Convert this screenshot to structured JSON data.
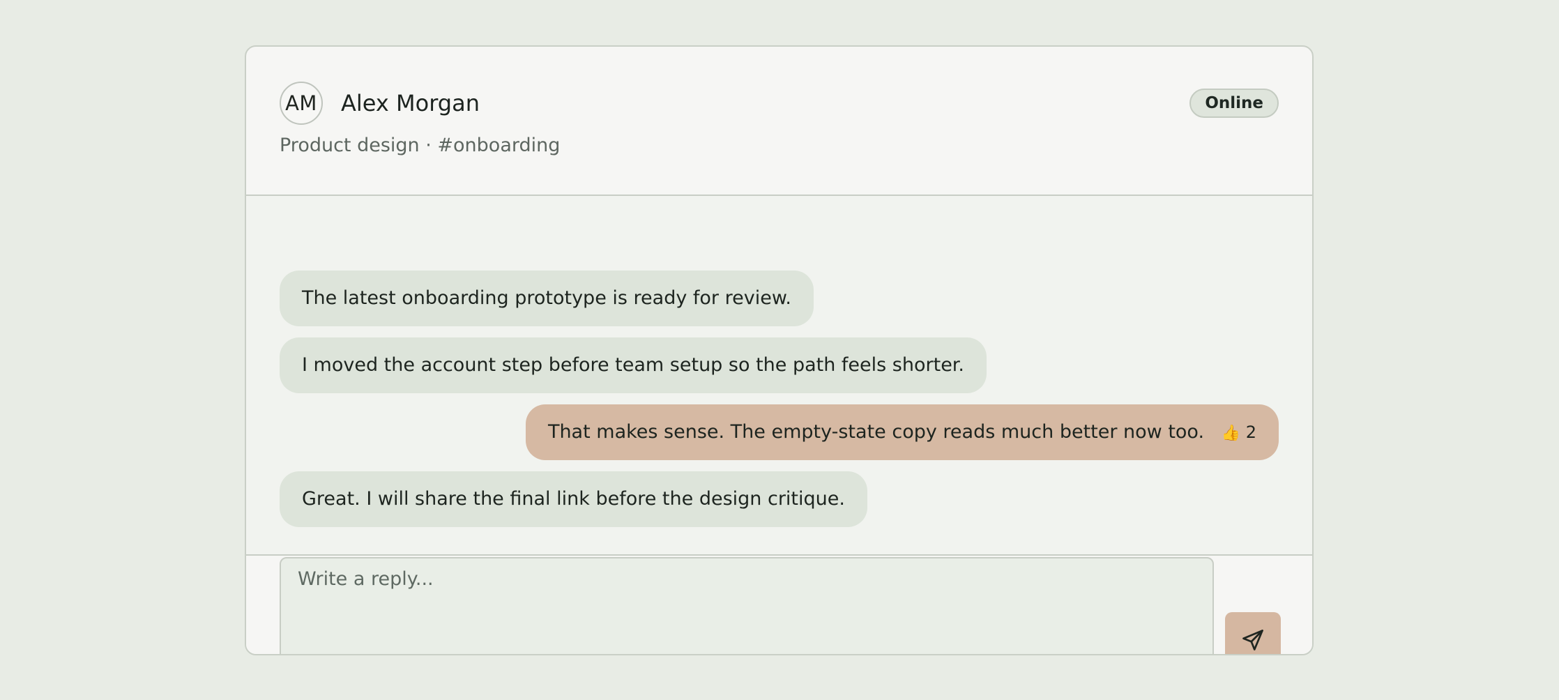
{
  "header": {
    "avatar_initials": "AM",
    "name": "Alex Morgan",
    "meta": "Product design · #onboarding",
    "status": "Online"
  },
  "messages": [
    {
      "direction": "incoming",
      "text": "The latest onboarding prototype is ready for review."
    },
    {
      "direction": "incoming",
      "text": "I moved the account step before team setup so the path feels shorter."
    },
    {
      "direction": "outgoing",
      "text": "That makes sense. The empty-state copy reads much better now too.",
      "reaction": {
        "emoji": "👍",
        "count": "2"
      }
    },
    {
      "direction": "incoming",
      "text": "Great. I will share the final link before the design critique."
    }
  ],
  "composer": {
    "placeholder": "Write a reply...",
    "send_icon": "send-icon"
  },
  "colors": {
    "page_background": "#e8ece5",
    "incoming_bubble": "#dde4da",
    "outgoing_bubble": "#d6b9a3",
    "send_button": "#d5b7a1"
  }
}
